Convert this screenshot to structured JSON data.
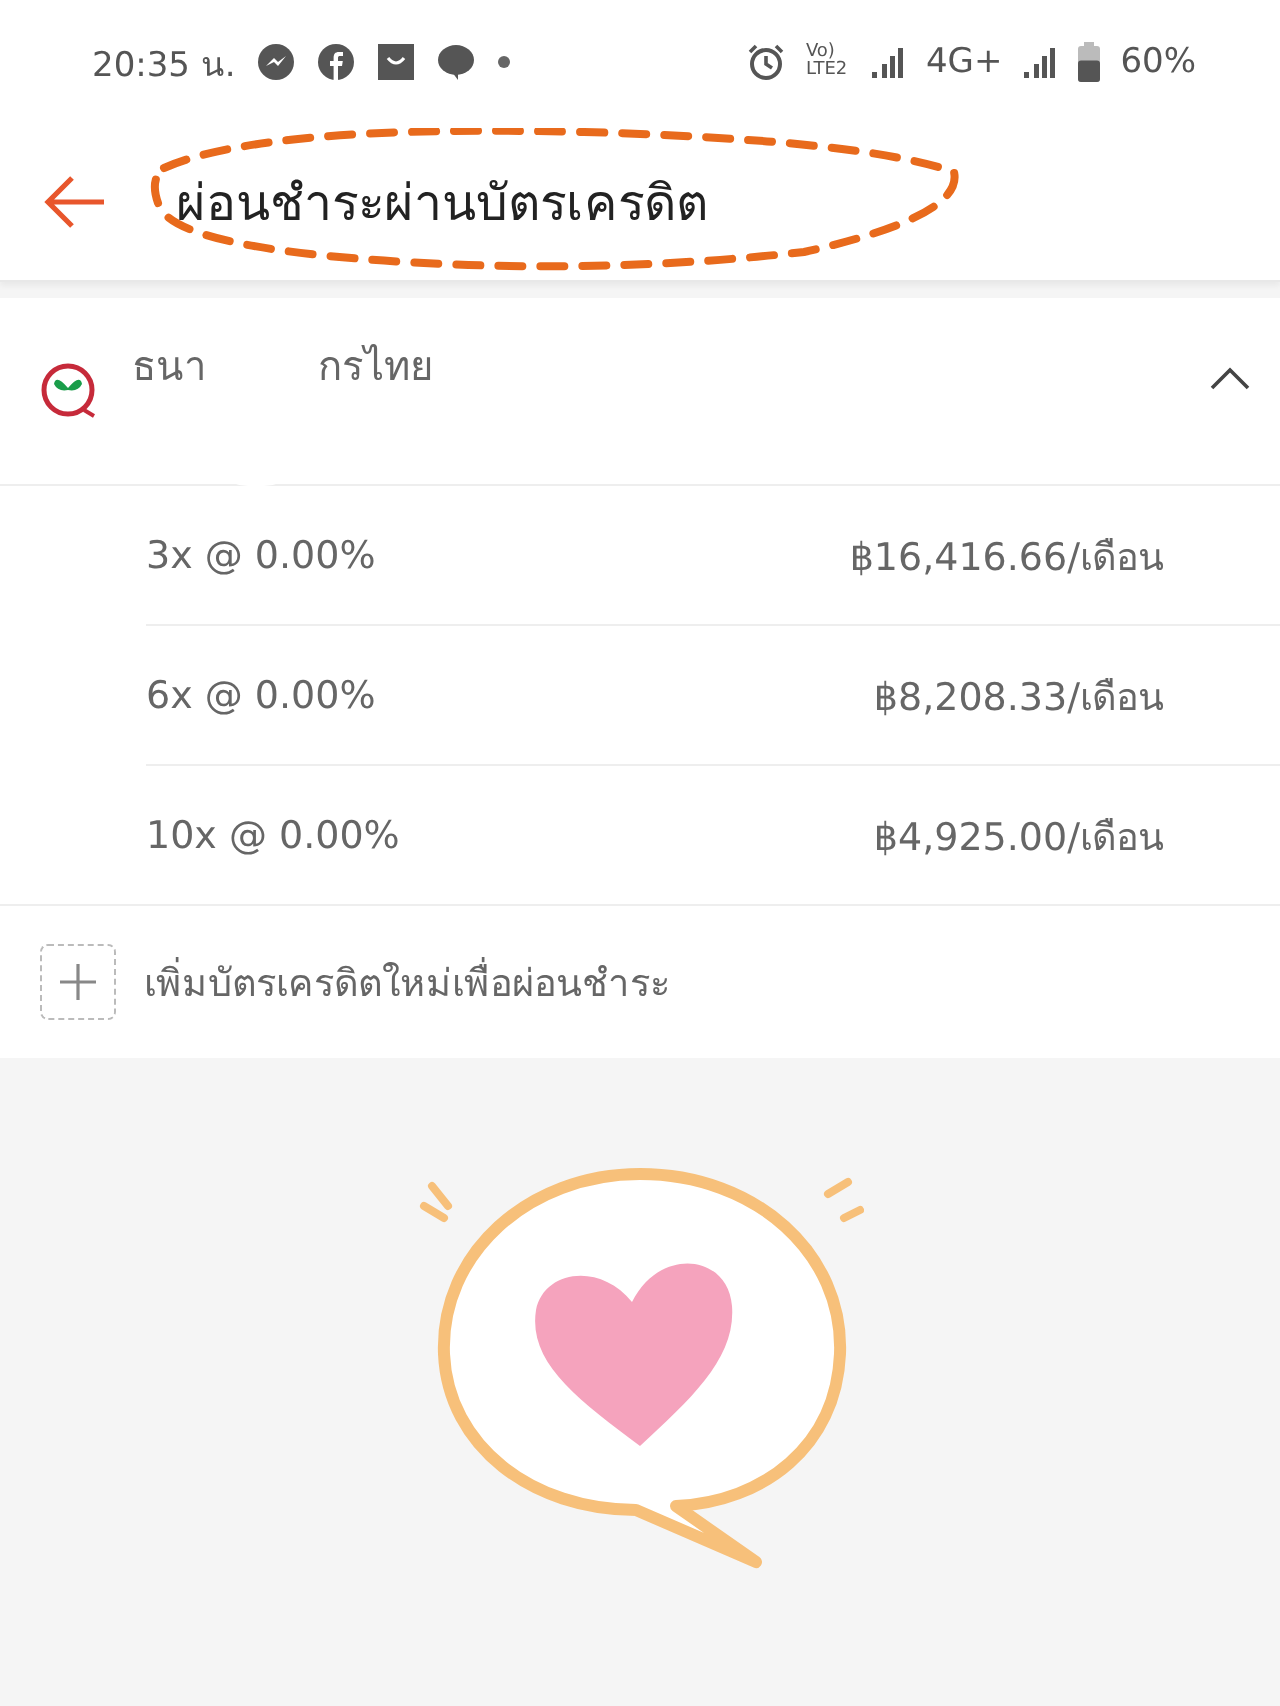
{
  "status_bar": {
    "time": "20:35 น.",
    "volte": "Vo) LTE2",
    "network": "4G+",
    "battery": "60%"
  },
  "header": {
    "title": "ผ่อนชำระผ่านบัตรเครดิต"
  },
  "bank": {
    "name_parts": [
      "ธนา",
      "กรไทย"
    ],
    "expanded": true
  },
  "plans": [
    {
      "term": "3x @ 0.00%",
      "amount": "฿16,416.66/เดือน"
    },
    {
      "term": "6x @ 0.00%",
      "amount": "฿8,208.33/เดือน"
    },
    {
      "term": "10x @ 0.00%",
      "amount": "฿4,925.00/เดือน"
    }
  ],
  "add_card": {
    "label": "เพิ่มบัตรเครดิตใหม่เพื่อผ่อนชำระ"
  }
}
